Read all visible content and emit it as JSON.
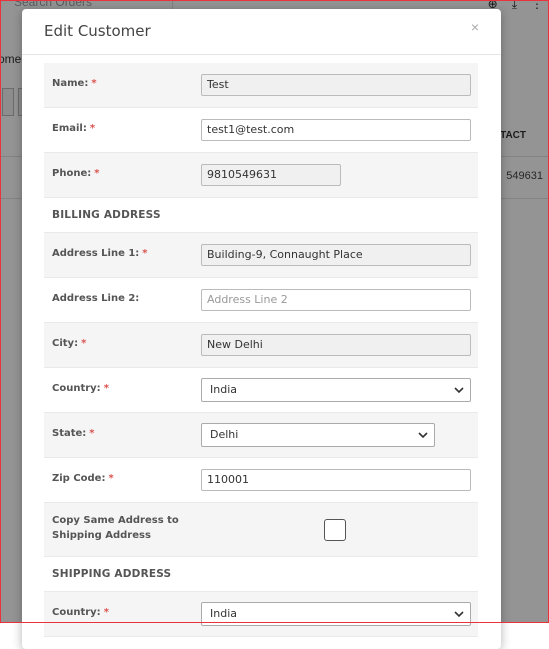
{
  "background": {
    "search_placeholder": "Search Orders",
    "breadcrumb": "ome",
    "column_header": "TACT",
    "phone_value": "549631"
  },
  "modal": {
    "title": "Edit Customer",
    "close_glyph": "×",
    "fields": {
      "name": {
        "label": "Name:",
        "value": "Test"
      },
      "email": {
        "label": "Email:",
        "value": "test1@test.com"
      },
      "phone": {
        "label": "Phone:",
        "value": "9810549631"
      },
      "billing_heading": "BILLING ADDRESS",
      "address1": {
        "label": "Address Line 1:",
        "value": "Building-9, Connaught Place"
      },
      "address2": {
        "label": "Address Line 2:",
        "placeholder": "Address Line 2"
      },
      "city": {
        "label": "City:",
        "value": "New Delhi"
      },
      "country": {
        "label": "Country:",
        "value": "India"
      },
      "state": {
        "label": "State:",
        "value": "Delhi"
      },
      "zip": {
        "label": "Zip Code:",
        "value": "110001"
      },
      "copy_address": {
        "label_line1": "Copy Same Address to",
        "label_line2": "Shipping Address",
        "checked": false
      },
      "shipping_heading": "SHIPPING ADDRESS",
      "shipping_country": {
        "label": "Country:",
        "value": "India"
      }
    },
    "required_marker": "*"
  },
  "colors": {
    "required": "#d9534f",
    "overlay": "rgba(0,0,0,0.42)",
    "frame_border": "#e8323c"
  }
}
